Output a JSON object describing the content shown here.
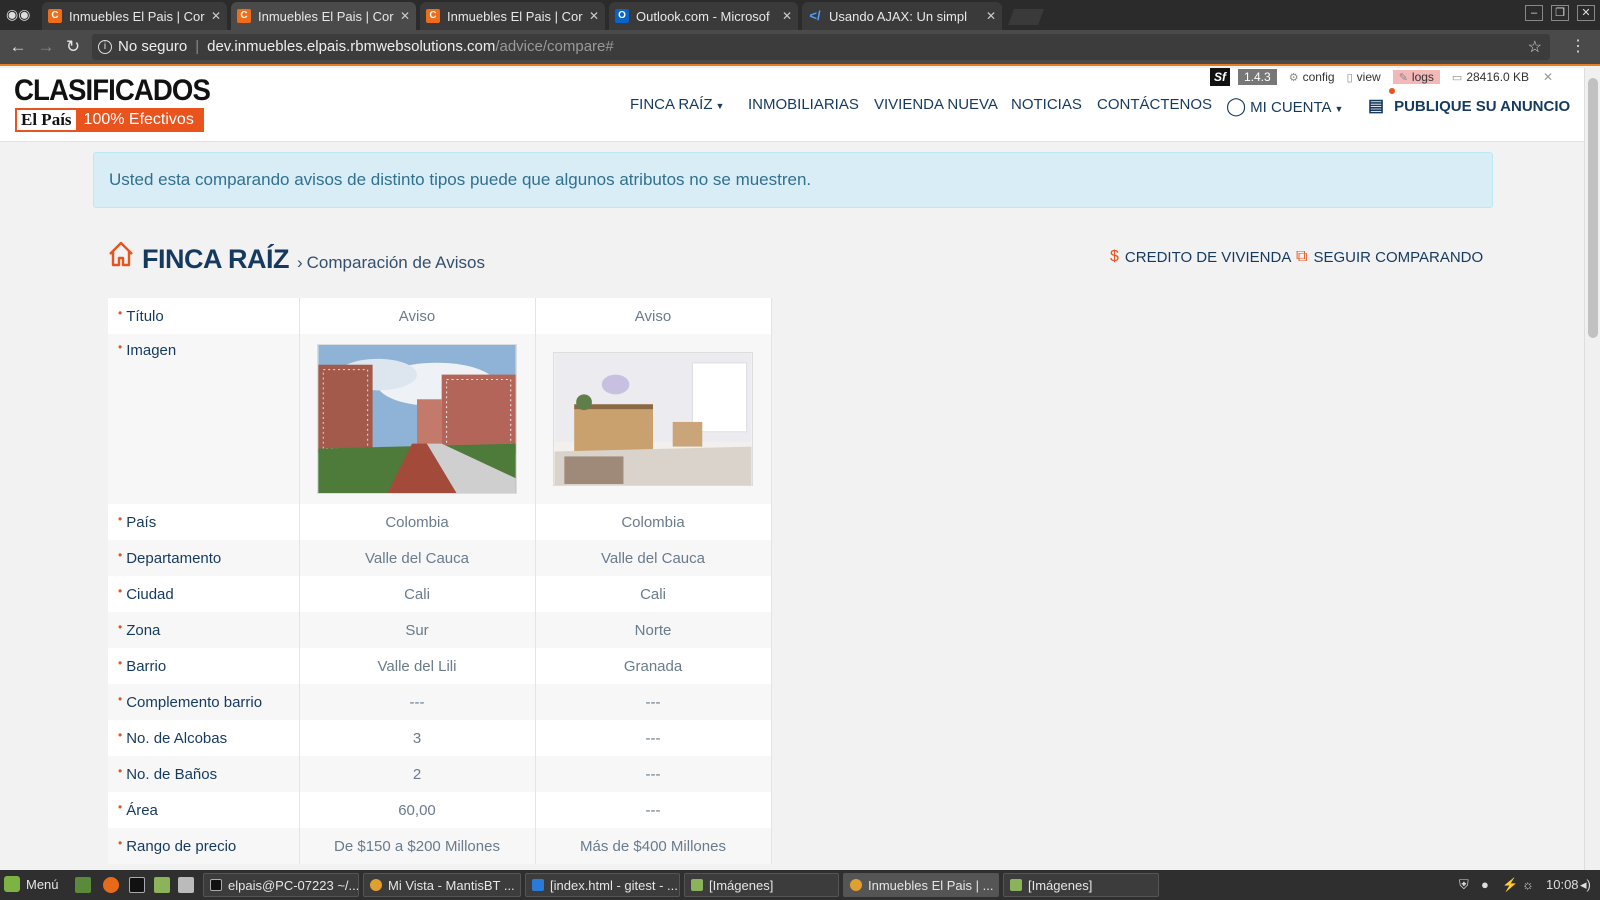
{
  "browser": {
    "tabs": [
      {
        "title": "Inmuebles El Pais | Cor",
        "icon": "c-favicon-icon",
        "active": false
      },
      {
        "title": "Inmuebles El Pais | Cor",
        "icon": "c-favicon-icon",
        "active": true
      },
      {
        "title": "Inmuebles El Pais | Cor",
        "icon": "c-favicon-icon",
        "active": false
      },
      {
        "title": "Outlook.com - Microsof",
        "icon": "outlook-icon",
        "active": false
      },
      {
        "title": "Usando AJAX: Un simpl",
        "icon": "vscode-icon",
        "active": false
      }
    ],
    "security_label": "No seguro",
    "url_host": "dev.inmuebles.elpais.rbmwebsolutions.com",
    "url_path": "/advice/compare#"
  },
  "symfony_bar": {
    "logo": "Sf",
    "version": "1.4.3",
    "config": "config",
    "view": "view",
    "logs": "logs",
    "memory": "28416.0 KB"
  },
  "header": {
    "logo_main": "CLASIFICADOS",
    "logo_elpais": "El País",
    "logo_tagline": "100% Efectivos",
    "nav": {
      "finca_raiz": "FINCA RAÍZ",
      "inmobiliarias": "INMOBILIARIAS",
      "vivienda_nueva": "VIVIENDA NUEVA",
      "noticias": "NOTICIAS",
      "contactenos": "CONTÁCTENOS",
      "mi_cuenta": "MI CUENTA",
      "publique": "PUBLIQUE SU ANUNCIO"
    }
  },
  "alert": "Usted esta comparando avisos de distinto tipos puede que algunos atributos no se muestren.",
  "breadcrumb": {
    "title": "FINCA RAÍZ",
    "separator": "›",
    "subtitle": "Comparación de Avisos"
  },
  "actions": {
    "credito": "CREDITO DE VIVIENDA",
    "seguir": "SEGUIR COMPARANDO"
  },
  "compare": {
    "title_label": "Título",
    "titles": [
      "Aviso",
      "Aviso"
    ],
    "image_label": "Imagen",
    "rows": [
      {
        "label": "País",
        "values": [
          "Colombia",
          "Colombia"
        ]
      },
      {
        "label": "Departamento",
        "values": [
          "Valle del Cauca",
          "Valle del Cauca"
        ]
      },
      {
        "label": "Ciudad",
        "values": [
          "Cali",
          "Cali"
        ]
      },
      {
        "label": "Zona",
        "values": [
          "Sur",
          "Norte"
        ]
      },
      {
        "label": "Barrio",
        "values": [
          "Valle del Lili",
          "Granada"
        ]
      },
      {
        "label": "Complemento barrio",
        "values": [
          "---",
          "---"
        ]
      },
      {
        "label": "No. de Alcobas",
        "values": [
          "3",
          "---"
        ]
      },
      {
        "label": "No. de Baños",
        "values": [
          "2",
          "---"
        ]
      },
      {
        "label": "Área",
        "values": [
          "60,00",
          "---"
        ]
      },
      {
        "label": "Rango de precio",
        "values": [
          "De $150 a $200 Millones",
          "Más de $400 Millones"
        ]
      }
    ]
  },
  "taskbar": {
    "menu": "Menú",
    "tasks": [
      "elpais@PC-07223 ~/...",
      "Mi Vista - MantisBT ...",
      "[index.html - gitest - ...",
      "[Imágenes]",
      "Inmuebles El Pais | ...",
      "[Imágenes]"
    ],
    "clock": "10:08"
  },
  "colors": {
    "brand_orange": "#e8531e",
    "brand_navy": "#163a5f",
    "alert_bg": "#d9edf7"
  }
}
